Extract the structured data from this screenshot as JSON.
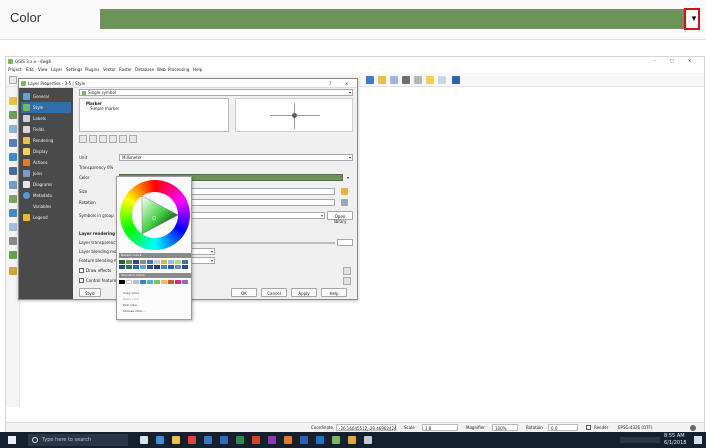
{
  "zoom": {
    "label": "Color",
    "swatch_color": "#6b9457",
    "dropdown_icon": "dropdown-arrow-icon",
    "highlight_color": "#d0121b"
  },
  "app": {
    "title": "QGIS 3.x.x - dwg8",
    "menu": [
      "Project",
      "Edit",
      "View",
      "Layer",
      "Settings",
      "Plugins",
      "Vector",
      "Raster",
      "Database",
      "Web",
      "Processing",
      "Help"
    ]
  },
  "dialog": {
    "title": "Layer Properties - 3-5 | Style",
    "sidebar": [
      {
        "label": "General",
        "color": "#5ea3d6"
      },
      {
        "label": "Style",
        "color": "#7bb661",
        "active": true
      },
      {
        "label": "Labels",
        "color": "#cfd3d8"
      },
      {
        "label": "Fields",
        "color": "#d9d9d9"
      },
      {
        "label": "Rendering",
        "color": "#f0c33c"
      },
      {
        "label": "Display",
        "color": "#f2d161"
      },
      {
        "label": "Actions",
        "color": "#e47c2d"
      },
      {
        "label": "Joins",
        "color": "#7c9bc4"
      },
      {
        "label": "Diagrams",
        "color": "#e6e6e6"
      },
      {
        "label": "Metadata",
        "color": "#5c96d1"
      },
      {
        "label": "Variables",
        "color": "#4b4b4b"
      },
      {
        "label": "Legend",
        "color": "#efb53b"
      }
    ],
    "renderer": "Single symbol",
    "tree": [
      "Marker",
      "Simple marker"
    ],
    "fields": {
      "unit_label": "Unit",
      "unit_value": "Millimeter",
      "transparency_label": "Transparency 0%",
      "color_label": "Color",
      "size_label": "Size",
      "size_value": "2.00000",
      "rotation_label": "Rotation",
      "rotation_value": "0.00 °",
      "symbols_label": "Symbols in group",
      "open_library": "Open library",
      "layer_rendering": "Layer rendering",
      "layer_transparency": "Layer transparency",
      "layer_blending": "Layer blending mode",
      "feature_blending": "Feature blending mode",
      "draw_effects": "Draw effects",
      "control_feature": "Control feature rendering order"
    },
    "buttons": {
      "style": "Style",
      "ok": "OK",
      "cancel": "Cancel",
      "apply": "Apply",
      "help": "Help"
    }
  },
  "picker": {
    "recent_label": "Recent colors",
    "standard_label": "Standard colors",
    "menu": [
      "Copy color",
      "Paste color",
      "Pick color",
      "Choose color..."
    ]
  },
  "statusbar": {
    "coordinate_label": "Coordinate",
    "coordinate_value": "-26.16045512,-29.46962424",
    "scale_label": "Scale",
    "scale_value": "1:8",
    "magnifier_label": "Magnifier",
    "magnifier_value": "100%",
    "rotation_label": "Rotation",
    "rotation_value": "0.0",
    "render_label": "Render",
    "crs": "EPSG:4326 (OTF)"
  },
  "taskbar": {
    "search_placeholder": "Type here to search",
    "time": "8:55 AM",
    "date": "6/1/2018"
  }
}
